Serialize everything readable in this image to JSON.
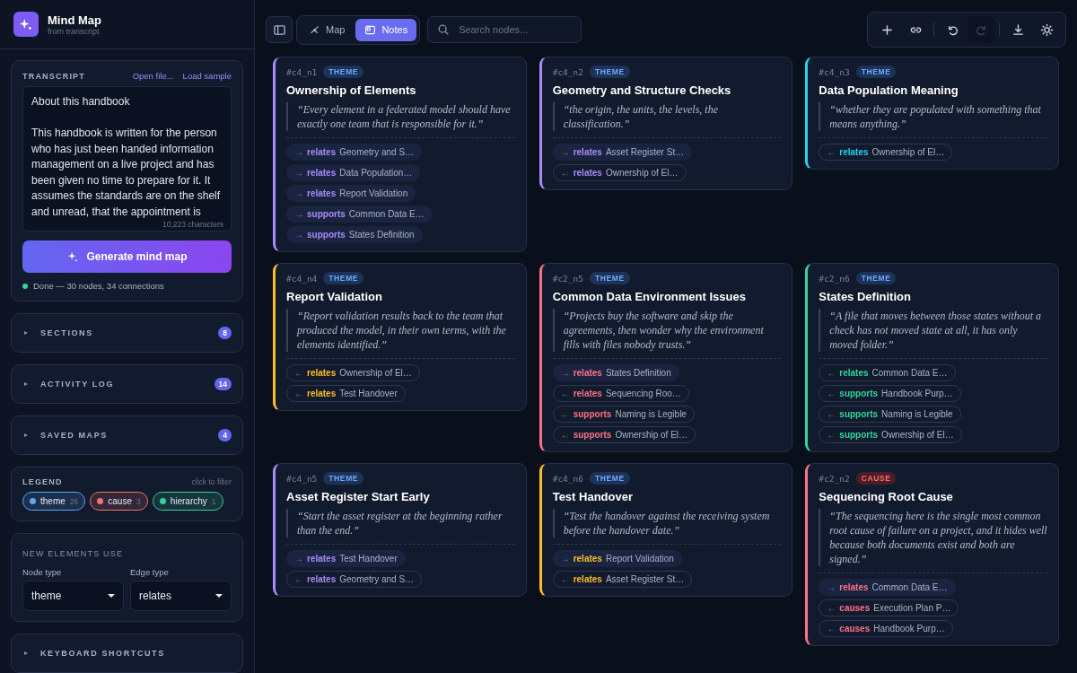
{
  "app": {
    "title": "Mind Map",
    "subtitle": "from transcript"
  },
  "transcript": {
    "heading": "TRANSCRIPT",
    "open_file": "Open file...",
    "load_sample": "Load sample",
    "value": "About this handbook\n\nThis handbook is written for the person who has just been handed information management on a live project and has been given no time to prepare for it. It assumes the standards are on the shelf and unread, that the appointment is",
    "char_count": "10,223 characters",
    "generate_button": "Generate mind map",
    "status": "Done — 30 nodes, 34 connections"
  },
  "sections": [
    {
      "label": "SECTIONS",
      "count": "8",
      "expanded": false
    },
    {
      "label": "ACTIVITY LOG",
      "count": "14",
      "expanded": false
    },
    {
      "label": "SAVED MAPS",
      "count": "4",
      "expanded": false
    }
  ],
  "legend": {
    "heading": "LEGEND",
    "hint": "click to filter",
    "items": [
      {
        "label": "theme",
        "count": "26",
        "color": "#60a5fa"
      },
      {
        "label": "cause",
        "count": "3",
        "color": "#f87171"
      },
      {
        "label": "hierarchy",
        "count": "1",
        "color": "#34d399"
      }
    ]
  },
  "new_elements": {
    "heading": "NEW ELEMENTS USE",
    "node_type_label": "Node type",
    "node_type": "theme",
    "edge_type_label": "Edge type",
    "edge_type": "relates"
  },
  "shortcuts": {
    "label": "KEYBOARD SHORTCUTS",
    "expanded": false
  },
  "toolbar": {
    "views": [
      {
        "label": "Map",
        "kind": "map",
        "selected": false
      },
      {
        "label": "Notes",
        "kind": "notes",
        "selected": true
      }
    ],
    "search_placeholder": "Search nodes...",
    "actions": [
      {
        "kind": "add",
        "disabled": false
      },
      {
        "kind": "link",
        "disabled": false
      },
      {
        "kind": "undo",
        "disabled": false
      },
      {
        "kind": "redo",
        "disabled": true
      },
      {
        "kind": "download",
        "disabled": false
      },
      {
        "kind": "theme",
        "disabled": false
      }
    ]
  },
  "cards": [
    {
      "id": "#c4_n1",
      "kind": "theme",
      "badge": "THEME",
      "color": "#a78bfa",
      "title": "Ownership of Elements",
      "quote": "“Every element in a federated model should have exactly one team that is responsible for it.”",
      "links": [
        {
          "kind": "outgoing",
          "arrow": "→",
          "relation": "relates",
          "target": "Geometry and S…"
        },
        {
          "kind": "outgoing",
          "arrow": "→",
          "relation": "relates",
          "target": "Data Population…"
        },
        {
          "kind": "outgoing",
          "arrow": "→",
          "relation": "relates",
          "target": "Report Validation"
        },
        {
          "kind": "outgoing",
          "arrow": "→",
          "relation": "supports",
          "target": "Common Data E…"
        },
        {
          "kind": "outgoing",
          "arrow": "→",
          "relation": "supports",
          "target": "States Definition"
        }
      ]
    },
    {
      "id": "#c4_n2",
      "kind": "theme",
      "badge": "THEME",
      "color": "#a78bfa",
      "title": "Geometry and Structure Checks",
      "quote": "“the origin, the units, the levels, the classification.”",
      "links": [
        {
          "kind": "outgoing",
          "arrow": "→",
          "relation": "relates",
          "target": "Asset Register St…"
        },
        {
          "kind": "incoming",
          "arrow": "←",
          "relation": "relates",
          "target": "Ownership of El…"
        }
      ]
    },
    {
      "id": "#c4_n3",
      "kind": "theme",
      "badge": "THEME",
      "color": "#22d3ee",
      "title": "Data Population Meaning",
      "quote": "“whether they are populated with something that means anything.”",
      "links": [
        {
          "kind": "incoming",
          "arrow": "←",
          "relation": "relates",
          "target": "Ownership of El…"
        }
      ]
    },
    {
      "id": "#c4_n4",
      "kind": "theme",
      "badge": "THEME",
      "color": "#fbbf24",
      "title": "Report Validation",
      "quote": "“Report validation results back to the team that produced the model, in their own terms, with the elements identified.”",
      "links": [
        {
          "kind": "incoming",
          "arrow": "←",
          "relation": "relates",
          "target": "Ownership of El…"
        },
        {
          "kind": "incoming",
          "arrow": "←",
          "relation": "relates",
          "target": "Test Handover"
        }
      ]
    },
    {
      "id": "#c2_n5",
      "kind": "theme",
      "badge": "THEME",
      "color": "#fb7185",
      "title": "Common Data Environment Issues",
      "quote": "“Projects buy the software and skip the agreements, then wonder why the environment fills with files nobody trusts.”",
      "links": [
        {
          "kind": "outgoing",
          "arrow": "→",
          "relation": "relates",
          "target": "States Definition"
        },
        {
          "kind": "incoming",
          "arrow": "←",
          "relation": "relates",
          "target": "Sequencing Roo…"
        },
        {
          "kind": "incoming",
          "arrow": "←",
          "relation": "supports",
          "target": "Naming is Legible"
        },
        {
          "kind": "incoming",
          "arrow": "←",
          "relation": "supports",
          "target": "Ownership of El…"
        }
      ]
    },
    {
      "id": "#c2_n6",
      "kind": "theme",
      "badge": "THEME",
      "color": "#34d399",
      "title": "States Definition",
      "quote": "“A file that moves between those states without a check has not moved state at all, it has only moved folder.”",
      "links": [
        {
          "kind": "incoming",
          "arrow": "←",
          "relation": "relates",
          "target": "Common Data E…"
        },
        {
          "kind": "incoming",
          "arrow": "←",
          "relation": "supports",
          "target": "Handbook Purp…"
        },
        {
          "kind": "incoming",
          "arrow": "←",
          "relation": "supports",
          "target": "Naming is Legible"
        },
        {
          "kind": "incoming",
          "arrow": "←",
          "relation": "supports",
          "target": "Ownership of El…"
        }
      ]
    },
    {
      "id": "#c4_n5",
      "kind": "theme",
      "badge": "THEME",
      "color": "#a78bfa",
      "title": "Asset Register Start Early",
      "quote": "“Start the asset register at the beginning rather than the end.”",
      "links": [
        {
          "kind": "outgoing",
          "arrow": "→",
          "relation": "relates",
          "target": "Test Handover"
        },
        {
          "kind": "incoming",
          "arrow": "←",
          "relation": "relates",
          "target": "Geometry and S…"
        }
      ]
    },
    {
      "id": "#c4_n6",
      "kind": "theme",
      "badge": "THEME",
      "color": "#fbbf24",
      "title": "Test Handover",
      "quote": "“Test the handover against the receiving system before the handover date.”",
      "links": [
        {
          "kind": "outgoing",
          "arrow": "→",
          "relation": "relates",
          "target": "Report Validation"
        },
        {
          "kind": "incoming",
          "arrow": "←",
          "relation": "relates",
          "target": "Asset Register St…"
        }
      ]
    },
    {
      "id": "#c2_n2",
      "kind": "cause",
      "badge": "CAUSE",
      "color": "#fb7185",
      "title": "Sequencing Root Cause",
      "quote": "“The sequencing here is the single most common root cause of failure on a project, and it hides well because both documents exist and both are signed.”",
      "links": [
        {
          "kind": "outgoing",
          "arrow": "→",
          "relation": "relates",
          "target": "Common Data E…"
        },
        {
          "kind": "incoming",
          "arrow": "←",
          "relation": "causes",
          "target": "Execution Plan P…"
        },
        {
          "kind": "incoming",
          "arrow": "←",
          "relation": "causes",
          "target": "Handbook Purp…"
        }
      ]
    }
  ]
}
